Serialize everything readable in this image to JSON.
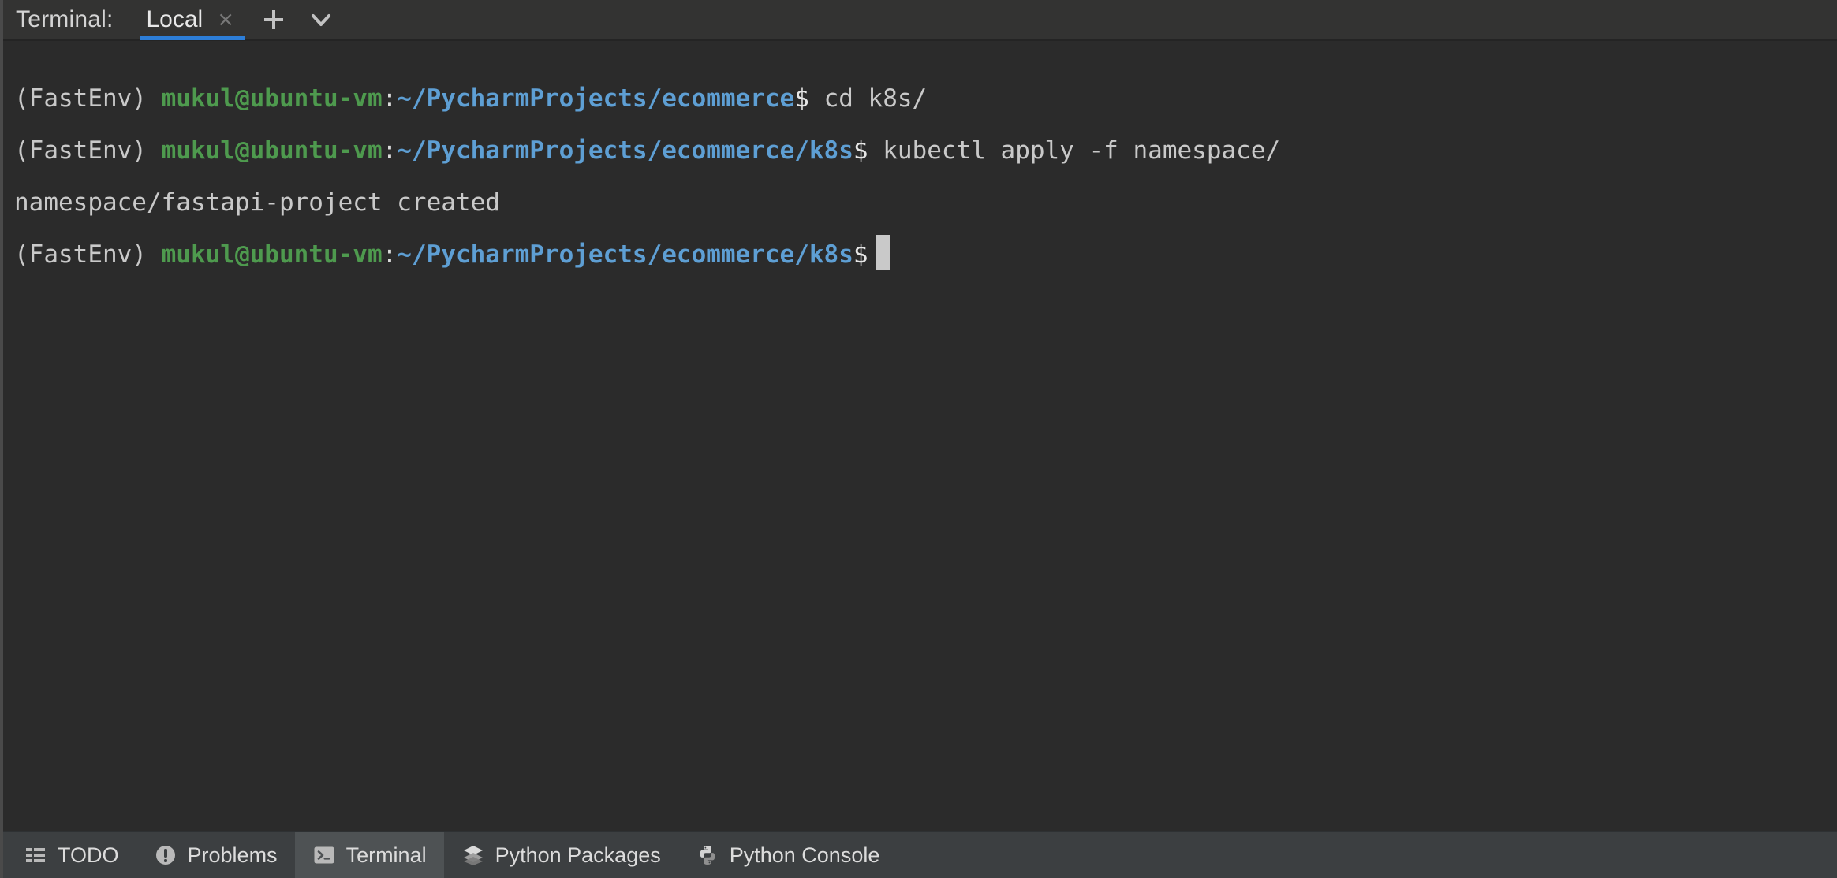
{
  "header": {
    "title": "Terminal:",
    "tab": {
      "label": "Local",
      "close_icon": "close-icon",
      "close_glyph": "×"
    },
    "add_tab_icon": "plus-icon",
    "dropdown_icon": "chevron-down-icon",
    "active_tab_underline_color": "#2d7ed8"
  },
  "terminal": {
    "background_color": "#2b2b2b",
    "colors": {
      "venv": "#c9c9c9",
      "user_host": "#4e9a4e",
      "path": "#5e9fd4",
      "dollar": "#e6e6e6",
      "command": "#c9c9c9",
      "output": "#c9c9c9",
      "cursor": "#c9c9c9"
    },
    "lines": [
      {
        "type": "prompt",
        "venv": "(FastEnv)",
        "user_host": "mukul@ubuntu-vm",
        "colon": ":",
        "path": "~/PycharmProjects/ecommerce",
        "dollar": "$",
        "command": "cd k8s/"
      },
      {
        "type": "prompt",
        "venv": "(FastEnv)",
        "user_host": "mukul@ubuntu-vm",
        "colon": ":",
        "path": "~/PycharmProjects/ecommerce/k8s",
        "dollar": "$",
        "command": "kubectl apply -f namespace/"
      },
      {
        "type": "output",
        "text": "namespace/fastapi-project created"
      },
      {
        "type": "prompt_cursor",
        "venv": "(FastEnv)",
        "user_host": "mukul@ubuntu-vm",
        "colon": ":",
        "path": "~/PycharmProjects/ecommerce/k8s",
        "dollar": "$",
        "command": ""
      }
    ]
  },
  "status_bar": {
    "background_color": "#3c3f41",
    "active_background_color": "#4e5254",
    "items": [
      {
        "label": "TODO",
        "icon": "todo-list-icon",
        "active": false
      },
      {
        "label": "Problems",
        "icon": "warning-circle-icon",
        "active": false
      },
      {
        "label": "Terminal",
        "icon": "terminal-icon",
        "active": true
      },
      {
        "label": "Python Packages",
        "icon": "layers-icon",
        "active": false
      },
      {
        "label": "Python Console",
        "icon": "python-logo-icon",
        "active": false
      }
    ]
  }
}
